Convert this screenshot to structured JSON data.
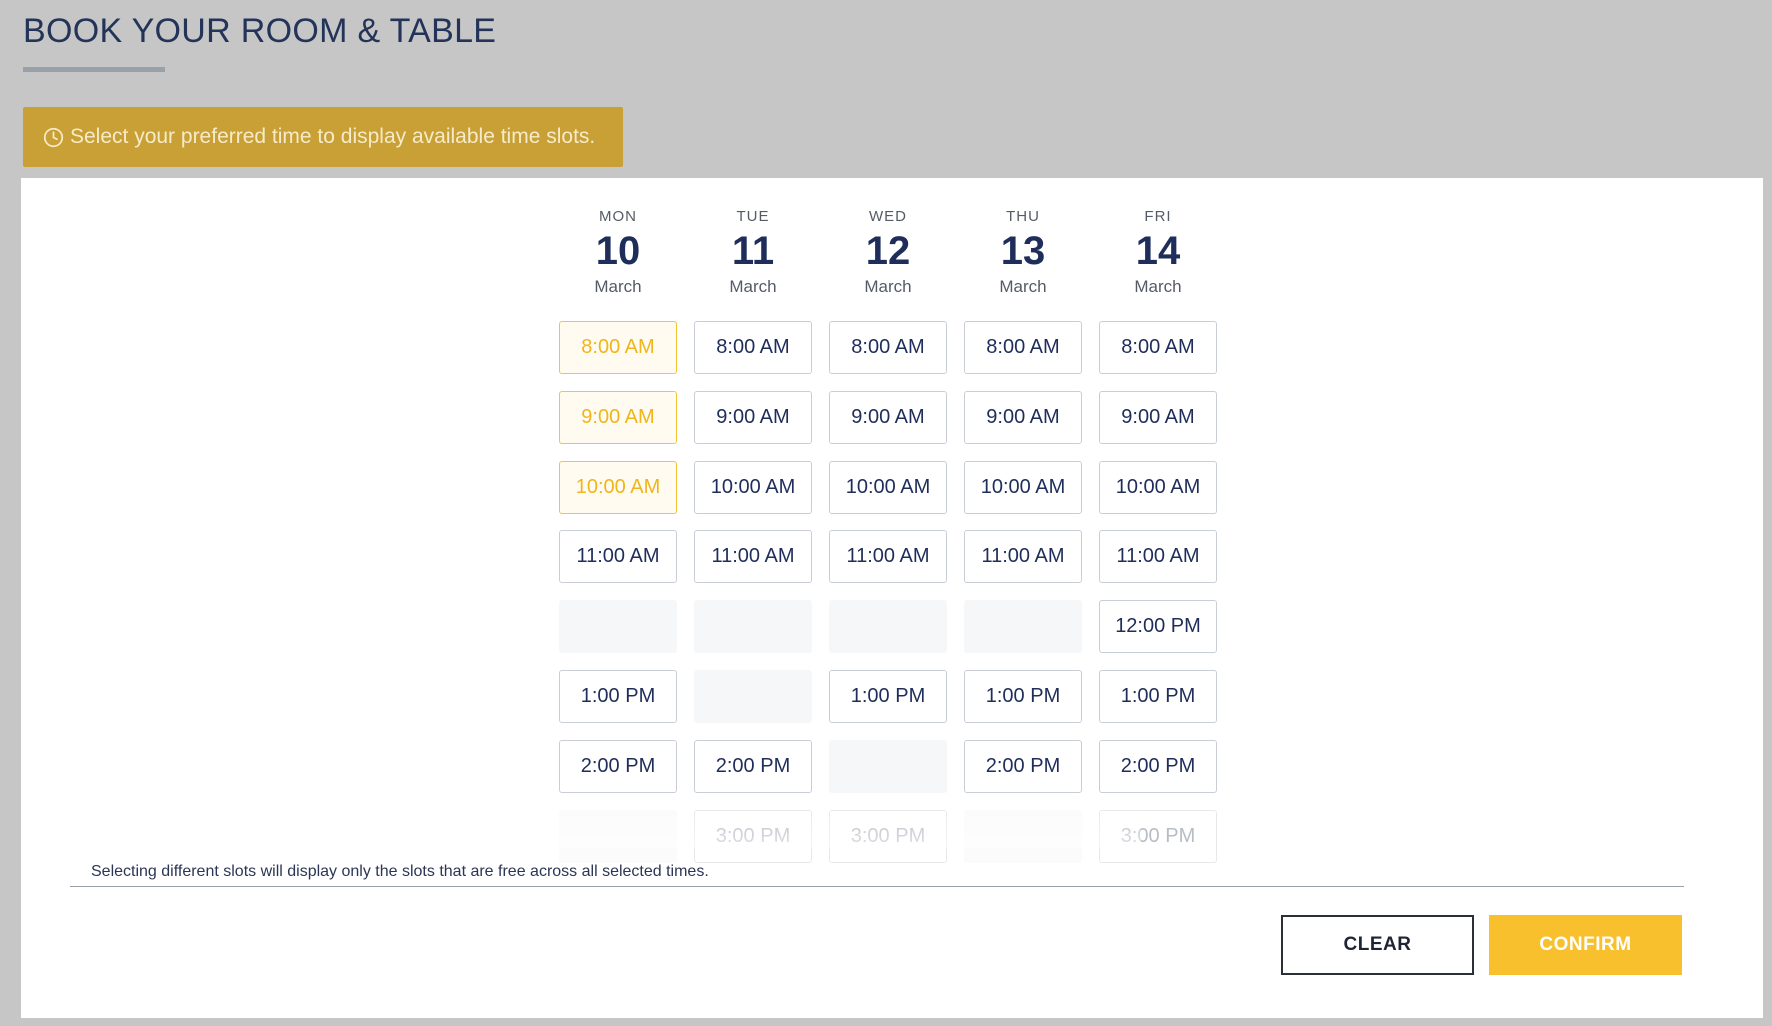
{
  "header": {
    "title": "BOOK YOUR ROOM & TABLE"
  },
  "notice": {
    "text": "Select your preferred time to display available time slots.",
    "icon": "clock-icon"
  },
  "days": [
    {
      "dow": "MON",
      "day": "10",
      "month": "March"
    },
    {
      "dow": "TUE",
      "day": "11",
      "month": "March"
    },
    {
      "dow": "WED",
      "day": "12",
      "month": "March"
    },
    {
      "dow": "THU",
      "day": "13",
      "month": "March"
    },
    {
      "dow": "FRI",
      "day": "14",
      "month": "March"
    }
  ],
  "slots": [
    [
      {
        "label": "8:00 AM",
        "state": "selected"
      },
      {
        "label": "9:00 AM",
        "state": "selected"
      },
      {
        "label": "10:00 AM",
        "state": "selected"
      },
      {
        "label": "11:00 AM",
        "state": "available"
      },
      {
        "label": "",
        "state": "empty"
      },
      {
        "label": "1:00 PM",
        "state": "available"
      },
      {
        "label": "2:00 PM",
        "state": "available"
      },
      {
        "label": "",
        "state": "faded-empty"
      }
    ],
    [
      {
        "label": "8:00 AM",
        "state": "available"
      },
      {
        "label": "9:00 AM",
        "state": "available"
      },
      {
        "label": "10:00 AM",
        "state": "available"
      },
      {
        "label": "11:00 AM",
        "state": "available"
      },
      {
        "label": "",
        "state": "empty"
      },
      {
        "label": "",
        "state": "empty"
      },
      {
        "label": "2:00 PM",
        "state": "available"
      },
      {
        "label": "3:00 PM",
        "state": "faded"
      }
    ],
    [
      {
        "label": "8:00 AM",
        "state": "available"
      },
      {
        "label": "9:00 AM",
        "state": "available"
      },
      {
        "label": "10:00 AM",
        "state": "available"
      },
      {
        "label": "11:00 AM",
        "state": "available"
      },
      {
        "label": "",
        "state": "empty"
      },
      {
        "label": "1:00 PM",
        "state": "available"
      },
      {
        "label": "",
        "state": "empty"
      },
      {
        "label": "3:00 PM",
        "state": "faded"
      }
    ],
    [
      {
        "label": "8:00 AM",
        "state": "available"
      },
      {
        "label": "9:00 AM",
        "state": "available"
      },
      {
        "label": "10:00 AM",
        "state": "available"
      },
      {
        "label": "11:00 AM",
        "state": "available"
      },
      {
        "label": "",
        "state": "empty"
      },
      {
        "label": "1:00 PM",
        "state": "available"
      },
      {
        "label": "2:00 PM",
        "state": "available"
      },
      {
        "label": "",
        "state": "faded-empty"
      }
    ],
    [
      {
        "label": "8:00 AM",
        "state": "available"
      },
      {
        "label": "9:00 AM",
        "state": "available"
      },
      {
        "label": "10:00 AM",
        "state": "available"
      },
      {
        "label": "11:00 AM",
        "state": "available"
      },
      {
        "label": "12:00 PM",
        "state": "available"
      },
      {
        "label": "1:00 PM",
        "state": "available"
      },
      {
        "label": "2:00 PM",
        "state": "available"
      },
      {
        "label": "3:00 PM",
        "state": "faded"
      }
    ]
  ],
  "hint": "Selecting different slots will display only the slots that are free across all selected times.",
  "actions": {
    "clear_label": "CLEAR",
    "confirm_label": "CONFIRM"
  },
  "colors": {
    "accent": "#f8c02c",
    "notice_bg": "#c9a035",
    "title": "#243459",
    "selected_text": "#f0b51b"
  }
}
